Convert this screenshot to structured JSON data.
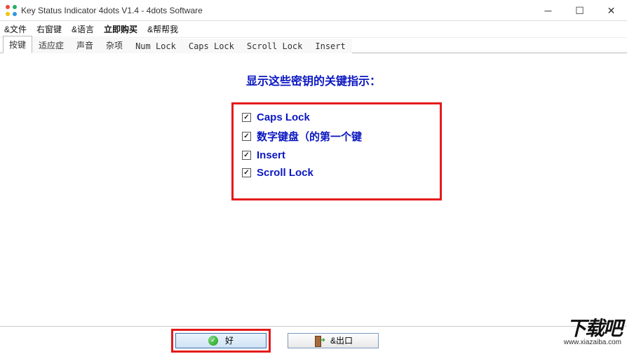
{
  "window": {
    "title": "Key Status Indicator 4dots V1.4 - 4dots Software"
  },
  "menu": {
    "file": "&文件",
    "right_window": "右窗键",
    "language": "&语言",
    "buy_now": "立即购买",
    "help": "&帮帮我"
  },
  "tabs": {
    "items": [
      {
        "label": "按键",
        "active": true
      },
      {
        "label": "适应症",
        "active": false
      },
      {
        "label": "声音",
        "active": false
      },
      {
        "label": "杂项",
        "active": false
      },
      {
        "label": "Num Lock",
        "active": false
      },
      {
        "label": "Caps Lock",
        "active": false
      },
      {
        "label": "Scroll Lock",
        "active": false
      },
      {
        "label": "Insert",
        "active": false
      }
    ]
  },
  "content": {
    "heading": "显示这些密钥的关键指示：",
    "checks": [
      {
        "label": "Caps Lock",
        "checked": true
      },
      {
        "label": "数字键盘（的第一个键",
        "checked": true
      },
      {
        "label": "Insert",
        "checked": true
      },
      {
        "label": "Scroll Lock",
        "checked": true
      }
    ]
  },
  "buttons": {
    "ok": "好",
    "exit": "&出口"
  },
  "watermark": {
    "text": "下载吧",
    "url": "www.xiazaiba.com"
  }
}
